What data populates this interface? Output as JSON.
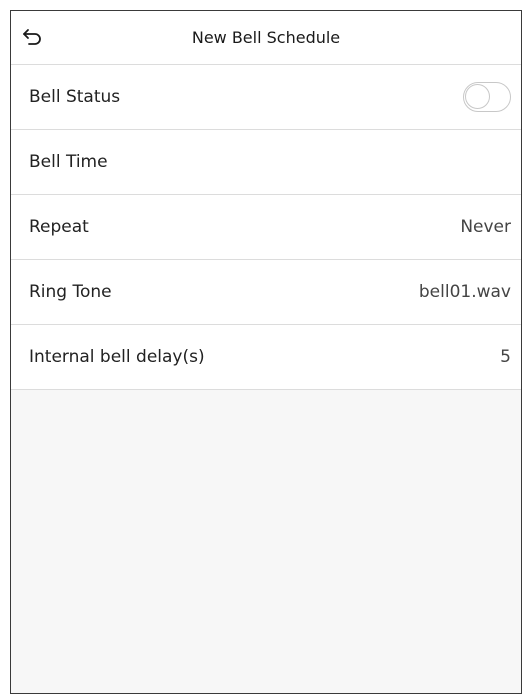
{
  "header": {
    "title": "New Bell Schedule",
    "back_icon": "back-arrow-icon"
  },
  "rows": [
    {
      "label": "Bell Status",
      "type": "toggle",
      "on": false
    },
    {
      "label": "Bell Time",
      "value": ""
    },
    {
      "label": "Repeat",
      "value": "Never"
    },
    {
      "label": "Ring Tone",
      "value": "bell01.wav"
    },
    {
      "label": "Internal bell delay(s)",
      "value": "5"
    }
  ],
  "colors": {
    "background": "#f7f7f7",
    "row_background": "#ffffff",
    "divider": "#dcdcdc",
    "toggle_border": "#c8c8c8"
  }
}
